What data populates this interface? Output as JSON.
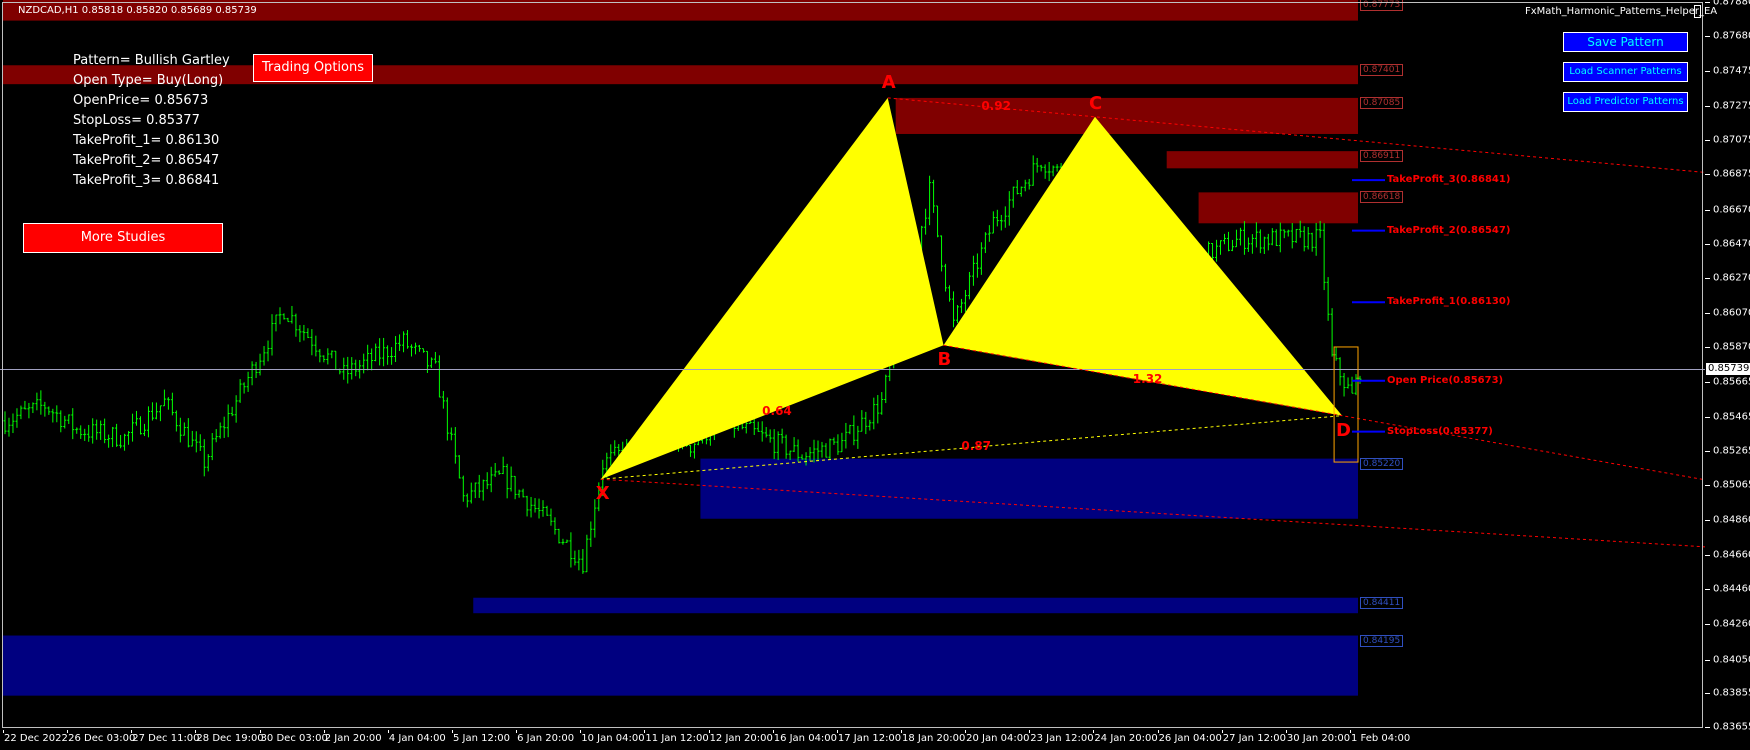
{
  "header": {
    "symbol_info": "NZDCAD,H1  0.85818 0.85820 0.85689 0.85739",
    "ea_name": "FxMath_Harmonic_Patterns_Helper_EA"
  },
  "info_panel": {
    "pattern": "Pattern= Bullish Gartley",
    "open_type": "Open Type= Buy(Long)",
    "open_price": "OpenPrice= 0.85673",
    "stop_loss": "StopLoss= 0.85377",
    "tp1": "TakeProfit_1= 0.86130",
    "tp2": "TakeProfit_2= 0.86547",
    "tp3": "TakeProfit_3= 0.86841"
  },
  "buttons": {
    "trading_options": "Trading Options",
    "more_studies": "More Studies",
    "save_pattern": "Save Pattern",
    "load_scanner": "Load Scanner Patterns",
    "load_predictor": "Load Predictor Patterns"
  },
  "colors": {
    "background": "#000000",
    "candles": "#00ff00",
    "pattern_fill": "#ffff00",
    "supply_zone": "#800000",
    "demand_zone": "#000080",
    "labels": "#ff0000",
    "level_lines": "#0000ff"
  },
  "chart_data": {
    "type": "candlestick",
    "symbol": "NZDCAD",
    "timeframe": "H1",
    "last_price": 0.85739,
    "ohlc_last": {
      "open": 0.85818,
      "high": 0.8582,
      "low": 0.85689,
      "close": 0.85739
    },
    "ylim": [
      0.8364,
      0.8789
    ],
    "y_ticks": [
      "0.87880",
      "0.87680",
      "0.87475",
      "0.87275",
      "0.87075",
      "0.86875",
      "0.86670",
      "0.86470",
      "0.86270",
      "0.86070",
      "0.85870",
      "0.85665",
      "0.85465",
      "0.85265",
      "0.85065",
      "0.84860",
      "0.84660",
      "0.84460",
      "0.84260",
      "0.84050",
      "0.83855",
      "0.83655"
    ],
    "y_tick_values": [
      0.8788,
      0.8768,
      0.87475,
      0.87275,
      0.87075,
      0.86875,
      0.8667,
      0.8647,
      0.8627,
      0.8607,
      0.8587,
      0.85665,
      0.85465,
      0.85265,
      0.85065,
      0.8486,
      0.8466,
      0.8446,
      0.8426,
      0.8405,
      0.83855,
      0.83655
    ],
    "x_ticks": [
      "22 Dec 2022",
      "26 Dec 03:00",
      "27 Dec 11:00",
      "28 Dec 19:00",
      "30 Dec 03:00",
      "2 Jan 20:00",
      "4 Jan 04:00",
      "5 Jan 12:00",
      "6 Jan 20:00",
      "10 Jan 04:00",
      "11 Jan 12:00",
      "12 Jan 20:00",
      "16 Jan 04:00",
      "17 Jan 12:00",
      "18 Jan 20:00",
      "20 Jan 04:00",
      "23 Jan 12:00",
      "24 Jan 20:00",
      "26 Jan 04:00",
      "27 Jan 12:00",
      "30 Jan 20:00",
      "1 Feb 04:00"
    ],
    "bars": 340,
    "price_path": [
      [
        0,
        0.8544
      ],
      [
        10,
        0.8553
      ],
      [
        18,
        0.8539
      ],
      [
        30,
        0.8534
      ],
      [
        40,
        0.8555
      ],
      [
        50,
        0.852
      ],
      [
        70,
        0.8609
      ],
      [
        85,
        0.8571
      ],
      [
        100,
        0.859
      ],
      [
        108,
        0.8573
      ],
      [
        115,
        0.8499
      ],
      [
        125,
        0.8512
      ],
      [
        135,
        0.8488
      ],
      [
        145,
        0.8462
      ],
      [
        150,
        0.8519
      ],
      [
        160,
        0.8532
      ],
      [
        163,
        0.8543
      ],
      [
        172,
        0.853
      ],
      [
        180,
        0.8545
      ],
      [
        200,
        0.8524
      ],
      [
        210,
        0.8531
      ],
      [
        220,
        0.8555
      ],
      [
        232,
        0.8678
      ],
      [
        238,
        0.86
      ],
      [
        248,
        0.866
      ],
      [
        260,
        0.8696
      ],
      [
        275,
        0.8671
      ],
      [
        285,
        0.8676
      ],
      [
        295,
        0.8634
      ],
      [
        310,
        0.865
      ],
      [
        330,
        0.865
      ],
      [
        333,
        0.858
      ],
      [
        338,
        0.8558
      ],
      [
        340,
        0.8574
      ]
    ],
    "pattern": {
      "name": "Bullish Gartley",
      "points": [
        {
          "label": "X",
          "bar": 150,
          "price": 0.851
        },
        {
          "label": "A",
          "bar": 222,
          "price": 0.8732
        },
        {
          "label": "B",
          "bar": 236,
          "price": 0.8588
        },
        {
          "label": "C",
          "bar": 274,
          "price": 0.8721
        },
        {
          "label": "D",
          "bar": 336,
          "price": 0.8547
        }
      ],
      "ratios": [
        {
          "label": "0.64",
          "between": [
            "X",
            "B"
          ]
        },
        {
          "label": "0.92",
          "between": [
            "A",
            "C"
          ]
        },
        {
          "label": "1.32",
          "between": [
            "B",
            "D"
          ]
        },
        {
          "label": "0.87",
          "between": [
            "X",
            "D"
          ]
        }
      ]
    },
    "levels": [
      {
        "label": "TakeProfit_3(0.86841)",
        "price": 0.86841
      },
      {
        "label": "TakeProfit_2(0.86547)",
        "price": 0.86547
      },
      {
        "label": "TakeProfit_1(0.86130)",
        "price": 0.8613
      },
      {
        "label": "Open Price(0.85673)",
        "price": 0.85673
      },
      {
        "label": "StopLoss(0.85377)",
        "price": 0.85377
      }
    ],
    "zones": [
      {
        "type": "supply",
        "from_bar": 0,
        "to_bar": 340,
        "top": 0.8789,
        "bottom": 0.8777,
        "tag": "0.87773"
      },
      {
        "type": "supply",
        "from_bar": 0,
        "to_bar": 340,
        "top": 0.8751,
        "bottom": 0.874,
        "tag": "0.87401"
      },
      {
        "type": "supply",
        "from_bar": 224,
        "to_bar": 340,
        "top": 0.8732,
        "bottom": 0.8711,
        "tag": "0.87085"
      },
      {
        "type": "supply",
        "from_bar": 292,
        "to_bar": 340,
        "top": 0.8701,
        "bottom": 0.8691,
        "tag": "0.86911"
      },
      {
        "type": "supply",
        "from_bar": 300,
        "to_bar": 340,
        "top": 0.8677,
        "bottom": 0.8659,
        "tag": "0.86618"
      },
      {
        "type": "demand",
        "from_bar": 175,
        "to_bar": 340,
        "top": 0.8522,
        "bottom": 0.8487,
        "tag": "0.85220"
      },
      {
        "type": "demand",
        "from_bar": 118,
        "to_bar": 340,
        "top": 0.8441,
        "bottom": 0.8432,
        "tag": "0.84411"
      },
      {
        "type": "demand",
        "from_bar": 0,
        "to_bar": 340,
        "top": 0.8419,
        "bottom": 0.8384,
        "tag": "0.84195"
      }
    ],
    "entry_box": {
      "from_bar": 334,
      "to_bar": 340,
      "top": 0.8587,
      "bottom": 0.852
    }
  }
}
